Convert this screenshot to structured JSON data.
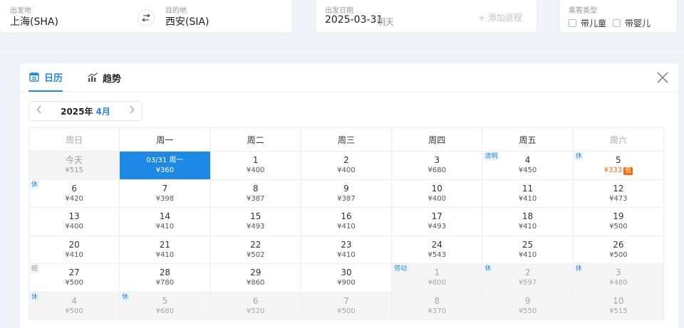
{
  "search": {
    "from_label": "出发地",
    "from_value": "上海(SHA)",
    "to_label": "目的地",
    "to_value": "西安(SIA)",
    "swap_icon": "swap-arrows-icon",
    "date_label": "出发日期",
    "date_value": "2025-03-31",
    "date_note": "明天",
    "add_return": "+ 添加返程",
    "passenger_label": "乘客类型",
    "child_label": "带儿童",
    "infant_label": "带婴儿"
  },
  "tabs": {
    "calendar": "日历",
    "trend": "趋势"
  },
  "month_nav": {
    "year": "2025年",
    "month": "4月"
  },
  "weekdays": [
    "周日",
    "周一",
    "周二",
    "周三",
    "周四",
    "周五",
    "周六"
  ],
  "colors": {
    "accent": "#1e88e5",
    "low_price": "#ff6600"
  },
  "calendar": [
    [
      {
        "day": "今天",
        "price": "¥515",
        "state": "past"
      },
      {
        "day": "03/31 周一",
        "price": "¥360",
        "state": "selected"
      },
      {
        "day": "1",
        "price": "¥400"
      },
      {
        "day": "2",
        "price": "¥400"
      },
      {
        "day": "3",
        "price": "¥680"
      },
      {
        "day": "4",
        "price": "¥450",
        "tag": "清明"
      },
      {
        "day": "5",
        "price": "¥333",
        "tag": "休",
        "low": "低"
      }
    ],
    [
      {
        "day": "6",
        "price": "¥420",
        "tag": "休"
      },
      {
        "day": "7",
        "price": "¥398"
      },
      {
        "day": "8",
        "price": "¥387"
      },
      {
        "day": "9",
        "price": "¥387"
      },
      {
        "day": "10",
        "price": "¥400"
      },
      {
        "day": "11",
        "price": "¥410"
      },
      {
        "day": "12",
        "price": "¥473"
      }
    ],
    [
      {
        "day": "13",
        "price": "¥400"
      },
      {
        "day": "14",
        "price": "¥410"
      },
      {
        "day": "15",
        "price": "¥493"
      },
      {
        "day": "16",
        "price": "¥410"
      },
      {
        "day": "17",
        "price": "¥493"
      },
      {
        "day": "18",
        "price": "¥410"
      },
      {
        "day": "19",
        "price": "¥500"
      }
    ],
    [
      {
        "day": "20",
        "price": "¥410"
      },
      {
        "day": "21",
        "price": "¥410"
      },
      {
        "day": "22",
        "price": "¥502"
      },
      {
        "day": "23",
        "price": "¥410"
      },
      {
        "day": "24",
        "price": "¥543"
      },
      {
        "day": "25",
        "price": "¥410"
      },
      {
        "day": "26",
        "price": "¥500"
      }
    ],
    [
      {
        "day": "27",
        "price": "¥500",
        "tag": "班",
        "tagType": "work"
      },
      {
        "day": "28",
        "price": "¥780"
      },
      {
        "day": "29",
        "price": "¥860"
      },
      {
        "day": "30",
        "price": "¥900"
      },
      {
        "day": "1",
        "price": "¥800",
        "tag": "劳动",
        "state": "next-month"
      },
      {
        "day": "2",
        "price": "¥597",
        "tag": "休",
        "state": "next-month"
      },
      {
        "day": "3",
        "price": "¥480",
        "tag": "休",
        "state": "next-month"
      }
    ],
    [
      {
        "day": "4",
        "price": "¥500",
        "tag": "休",
        "state": "next-month"
      },
      {
        "day": "5",
        "price": "¥680",
        "tag": "休",
        "state": "next-month"
      },
      {
        "day": "6",
        "price": "¥520",
        "state": "next-month"
      },
      {
        "day": "7",
        "price": "¥500",
        "state": "next-month"
      },
      {
        "day": "8",
        "price": "¥370",
        "state": "next-month"
      },
      {
        "day": "9",
        "price": "¥550",
        "state": "next-month"
      },
      {
        "day": "10",
        "price": "¥515",
        "state": "next-month"
      }
    ]
  ]
}
